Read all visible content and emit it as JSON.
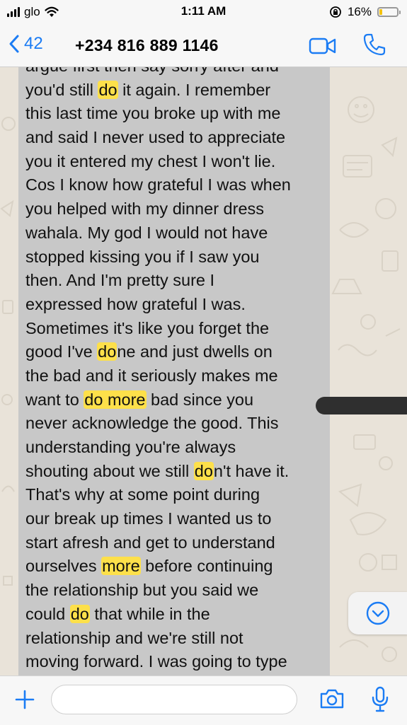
{
  "status": {
    "carrier": "glo",
    "time": "1:11 AM",
    "battery": "16%",
    "battery_level": 0.16
  },
  "header": {
    "back_count": "42",
    "contact": "+234 816 889 1146"
  },
  "message": {
    "lines": [
      [
        {
          "t": "argue first then say sorry after and"
        }
      ],
      [
        {
          "t": "you'd still "
        },
        {
          "t": "do",
          "h": true
        },
        {
          "t": " it again. I remember"
        }
      ],
      [
        {
          "t": "this last time you broke up with me"
        }
      ],
      [
        {
          "t": "and said I never used to appreciate"
        }
      ],
      [
        {
          "t": "you it entered my chest I won't lie."
        }
      ],
      [
        {
          "t": "Cos I know how grateful I was when"
        }
      ],
      [
        {
          "t": "you helped with my dinner dress"
        }
      ],
      [
        {
          "t": "wahala. My god I would not have"
        }
      ],
      [
        {
          "t": "stopped kissing you if I saw you"
        }
      ],
      [
        {
          "t": "then. And I'm pretty sure I"
        }
      ],
      [
        {
          "t": "expressed how grateful I was."
        }
      ],
      [
        {
          "t": "Sometimes it's like you forget the"
        }
      ],
      [
        {
          "t": "good I've "
        },
        {
          "t": "do",
          "h": true
        },
        {
          "t": "ne and just dwells on"
        }
      ],
      [
        {
          "t": "the bad and it seriously makes me"
        }
      ],
      [
        {
          "t": "want to "
        },
        {
          "t": "do more",
          "h": true
        },
        {
          "t": " bad since you"
        }
      ],
      [
        {
          "t": "never acknowledge the good. This"
        }
      ],
      [
        {
          "t": "understanding you're always"
        }
      ],
      [
        {
          "t": "shouting about we still "
        },
        {
          "t": "do",
          "h": true
        },
        {
          "t": "n't have it."
        }
      ],
      [
        {
          "t": "That's why at some point during"
        }
      ],
      [
        {
          "t": "our break up times I wanted us to"
        }
      ],
      [
        {
          "t": "start afresh and get to understand"
        }
      ],
      [
        {
          "t": "ourselves "
        },
        {
          "t": "more",
          "h": true
        },
        {
          "t": " before continuing"
        }
      ],
      [
        {
          "t": "the relationship but you said we"
        }
      ],
      [
        {
          "t": "could "
        },
        {
          "t": "do",
          "h": true
        },
        {
          "t": " that while in the"
        }
      ],
      [
        {
          "t": "relationship and we're still not"
        }
      ],
      [
        {
          "t": "moving forward. I was going to type"
        }
      ]
    ]
  },
  "input": {
    "value": "",
    "placeholder": ""
  },
  "icons": {
    "back": "chevron-left-icon",
    "video": "video-call-icon",
    "call": "phone-icon",
    "scroll": "chevron-down-circle-icon",
    "attach": "plus-icon",
    "camera": "camera-icon",
    "mic": "microphone-icon"
  },
  "colors": {
    "accent": "#1b7cf4",
    "highlight": "#fde04a",
    "bubble": "#c8c8c8",
    "battery": "#f4c20d"
  }
}
